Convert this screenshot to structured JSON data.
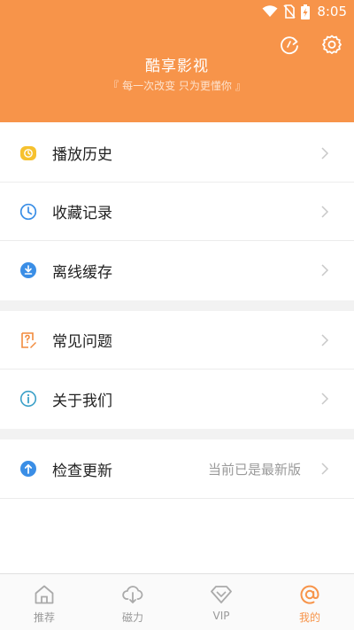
{
  "status": {
    "time": "8:05"
  },
  "app": {
    "title": "酷享影视",
    "slogan": "『 每一次改变  只为更懂你 』"
  },
  "menu_group_1": [
    {
      "label": "播放历史",
      "icon": "play-history-icon"
    },
    {
      "label": "收藏记录",
      "icon": "clock-icon"
    },
    {
      "label": "离线缓存",
      "icon": "download-icon"
    }
  ],
  "menu_group_2": [
    {
      "label": "常见问题",
      "icon": "faq-icon"
    },
    {
      "label": "关于我们",
      "icon": "info-icon"
    }
  ],
  "menu_group_3": [
    {
      "label": "检查更新",
      "value": "当前已是最新版",
      "icon": "update-icon"
    }
  ],
  "tabs": [
    {
      "label": "推荐",
      "icon": "home-icon",
      "active": false
    },
    {
      "label": "磁力",
      "icon": "cloud-download-icon",
      "active": false
    },
    {
      "label": "VIP",
      "icon": "diamond-icon",
      "active": false
    },
    {
      "label": "我的",
      "icon": "at-icon",
      "active": true
    }
  ],
  "colors": {
    "accent": "#F7944A",
    "icon_blue": "#3A8EE6",
    "icon_yellow": "#F6C12E",
    "icon_orange": "#F28A3C",
    "icon_teal": "#3BA0C8"
  }
}
